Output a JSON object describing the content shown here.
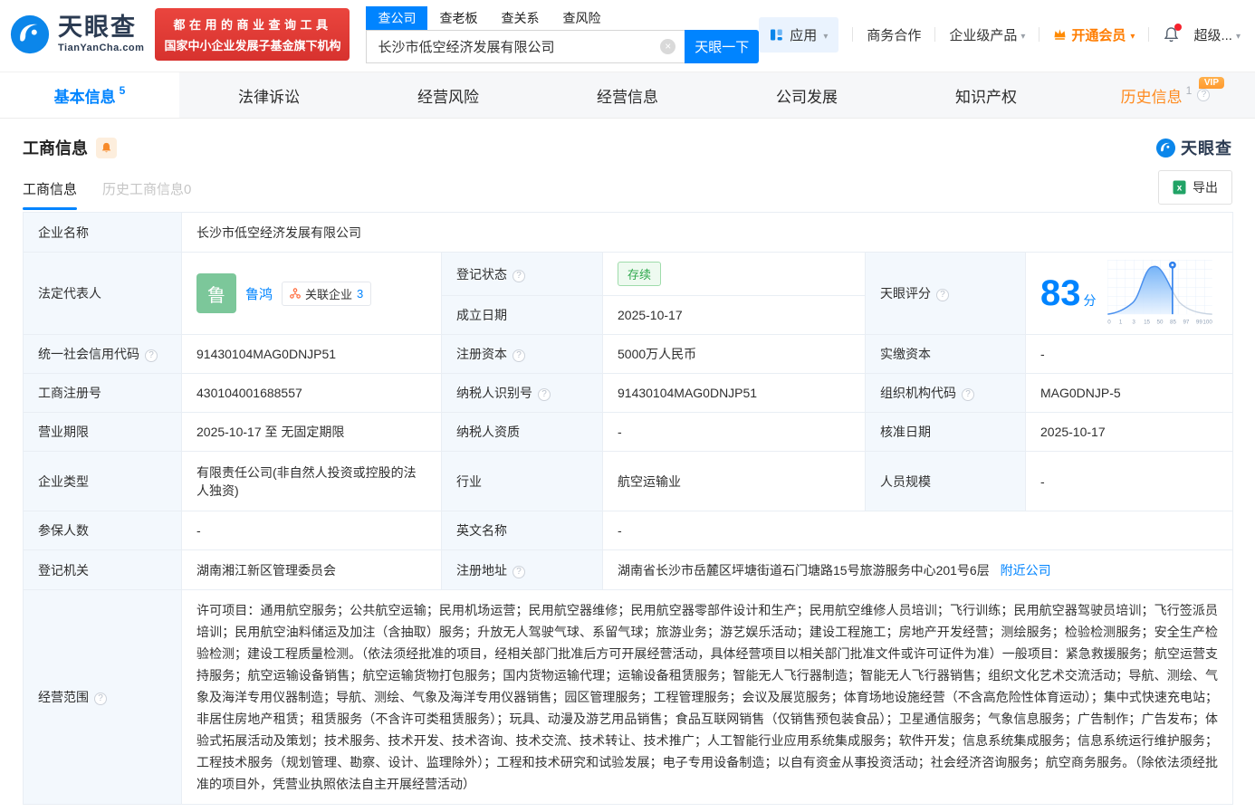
{
  "colors": {
    "brand_blue": "#0084ff",
    "vip_orange": "#ff7d00",
    "history_tab_orange": "#ff8a1e",
    "status_green": "#2ea84c",
    "promo_red": "#df382f",
    "excel_green": "#21a366",
    "avatar_green": "#7cc79a"
  },
  "icons": {
    "logo": "tianyancha-swirl-icon",
    "search_clear": "circle-x-icon",
    "apps": "app-grid-icon",
    "vip": "crown-icon",
    "notification": "bell-icon-with-red-dot",
    "question": "circle-question-icon",
    "monitor": "bell-icon",
    "export": "excel-icon",
    "related": "org-network-icon",
    "vip_badge_text": "VIP"
  },
  "header": {
    "logo": {
      "title": "天眼查",
      "subtitle": "TianYanCha.com"
    },
    "promo": {
      "line1": "都在用的商业查询工具",
      "line2": "国家中小企业发展子基金旗下机构"
    },
    "search": {
      "tabs": [
        {
          "label": "查公司",
          "active": true
        },
        {
          "label": "查老板",
          "active": false
        },
        {
          "label": "查关系",
          "active": false
        },
        {
          "label": "查风险",
          "active": false
        }
      ],
      "value": "长沙市低空经济发展有限公司",
      "button": "天眼一下"
    },
    "nav": {
      "apps": "应用",
      "cooperation": "商务合作",
      "enterprise": "企业级产品",
      "vip": "开通会员",
      "super": "超级..."
    }
  },
  "tabs": [
    {
      "label": "基本信息",
      "count": "5",
      "active": true
    },
    {
      "label": "法律诉讼"
    },
    {
      "label": "经营风险"
    },
    {
      "label": "经营信息"
    },
    {
      "label": "公司发展"
    },
    {
      "label": "知识产权"
    },
    {
      "label": "历史信息",
      "count": "1",
      "vip_badge": "VIP"
    }
  ],
  "section": {
    "title": "工商信息",
    "watermark": "天眼查",
    "subtabs": [
      {
        "label": "工商信息",
        "active": true
      },
      {
        "label": "历史工商信息0",
        "active": false
      }
    ],
    "export": "导出"
  },
  "fields": {
    "company_name": {
      "label": "企业名称",
      "value": "长沙市低空经济发展有限公司"
    },
    "legal_rep": {
      "label": "法定代表人"
    },
    "reg_status": {
      "label": "登记状态",
      "value": "存续"
    },
    "establish_date": {
      "label": "成立日期",
      "value": "2025-10-17"
    },
    "score": {
      "label": "天眼评分",
      "value": "83",
      "unit": "分"
    },
    "credit_code": {
      "label": "统一社会信用代码",
      "value": "91430104MAG0DNJP51"
    },
    "reg_capital": {
      "label": "注册资本",
      "value": "5000万人民币"
    },
    "paid_capital": {
      "label": "实缴资本",
      "value": "-"
    },
    "reg_number": {
      "label": "工商注册号",
      "value": "430104001688557"
    },
    "taxpayer_id": {
      "label": "纳税人识别号",
      "value": "91430104MAG0DNJP51"
    },
    "org_code": {
      "label": "组织机构代码",
      "value": "MAG0DNJP-5"
    },
    "business_term": {
      "label": "营业期限",
      "value": "2025-10-17 至 无固定期限"
    },
    "taxpayer_quality": {
      "label": "纳税人资质",
      "value": "-"
    },
    "approval_date": {
      "label": "核准日期",
      "value": "2025-10-17"
    },
    "company_type": {
      "label": "企业类型",
      "value": "有限责任公司(非自然人投资或控股的法人独资)"
    },
    "industry": {
      "label": "行业",
      "value": "航空运输业"
    },
    "staff_size": {
      "label": "人员规模",
      "value": "-"
    },
    "insured_count": {
      "label": "参保人数",
      "value": "-"
    },
    "english_name": {
      "label": "英文名称",
      "value": "-"
    },
    "reg_authority": {
      "label": "登记机关",
      "value": "湖南湘江新区管理委员会"
    },
    "reg_address": {
      "label": "注册地址",
      "value": "湖南省长沙市岳麓区坪塘街道石门塘路15号旅游服务中心201号6层",
      "nearby_link": "附近公司"
    },
    "business_scope": {
      "label": "经营范围",
      "value": "许可项目：通用航空服务；公共航空运输；民用机场运营；民用航空器维修；民用航空器零部件设计和生产；民用航空维修人员培训；飞行训练；民用航空器驾驶员培训；飞行签派员培训；民用航空油料储运及加注（含抽取）服务；升放无人驾驶气球、系留气球；旅游业务；游艺娱乐活动；建设工程施工；房地产开发经营；测绘服务；检验检测服务；安全生产检验检测；建设工程质量检测。（依法须经批准的项目，经相关部门批准后方可开展经营活动，具体经营项目以相关部门批准文件或许可证件为准）一般项目：紧急救援服务；航空运营支持服务；航空运输设备销售；航空运输货物打包服务；国内货物运输代理；运输设备租赁服务；智能无人飞行器制造；智能无人飞行器销售；组织文化艺术交流活动；导航、测绘、气象及海洋专用仪器制造；导航、测绘、气象及海洋专用仪器销售；园区管理服务；工程管理服务；会议及展览服务；体育场地设施经营（不含高危险性体育运动）；集中式快速充电站；非居住房地产租赁；租赁服务（不含许可类租赁服务）；玩具、动漫及游艺用品销售；食品互联网销售（仅销售预包装食品）；卫星通信服务；气象信息服务；广告制作；广告发布；体验式拓展活动及策划；技术服务、技术开发、技术咨询、技术交流、技术转让、技术推广；人工智能行业应用系统集成服务；软件开发；信息系统集成服务；信息系统运行维护服务；工程技术服务（规划管理、勘察、设计、监理除外）；工程和技术研究和试验发展；电子专用设备制造；以自有资金从事投资活动；社会经济咨询服务；航空商务服务。（除依法须经批准的项目外，凭营业执照依法自主开展经营活动）"
    }
  },
  "legal_rep": {
    "avatar": "鲁",
    "name": "鲁鸿",
    "related_label": "关联企业",
    "related_count": "3"
  },
  "chart_data": {
    "type": "area",
    "title": "天眼评分",
    "score": 83,
    "score_unit": "分",
    "x_tick_labels": [
      "0",
      "1",
      "3",
      "15",
      "50",
      "85",
      "97",
      "99",
      "100"
    ],
    "marker_value": 83,
    "curve_shape": "bell-shaped score distribution; area left of marker filled blue, right tail gray",
    "legend_position": "none",
    "grid": true
  }
}
